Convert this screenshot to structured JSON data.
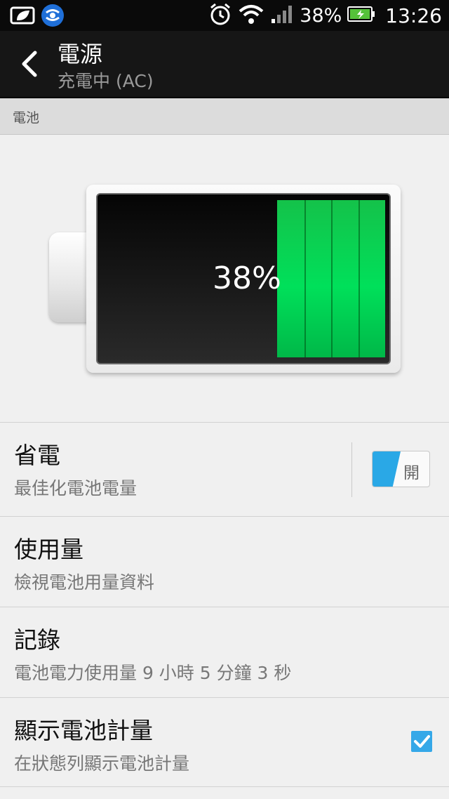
{
  "status_bar": {
    "left_icons": [
      "leaf-icon",
      "carrier-icon"
    ],
    "right_icons": [
      "alarm-icon",
      "wifi-icon",
      "signal-icon",
      "battery-charging-icon"
    ],
    "battery_percent": "38%",
    "time": "13:26"
  },
  "action_bar": {
    "title": "電源",
    "subtitle": "充電中 (AC)"
  },
  "section": {
    "header": "電池"
  },
  "battery": {
    "percent_label": "38%",
    "level": 0.38,
    "fill_color": "#00d050"
  },
  "settings": [
    {
      "title": "省電",
      "subtitle": "最佳化電池電量",
      "control": "toggle",
      "toggle_label": "開"
    },
    {
      "title": "使用量",
      "subtitle": "檢視電池用量資料"
    },
    {
      "title": "記錄",
      "subtitle": "電池電力使用量 9 小時 5 分鐘 3 秒"
    },
    {
      "title": "顯示電池計量",
      "subtitle": "在狀態列顯示電池計量",
      "control": "checkbox",
      "checked": true
    }
  ],
  "colors": {
    "accent": "#35a8e8",
    "background": "#f0f0f0",
    "action_bar": "#161616"
  }
}
